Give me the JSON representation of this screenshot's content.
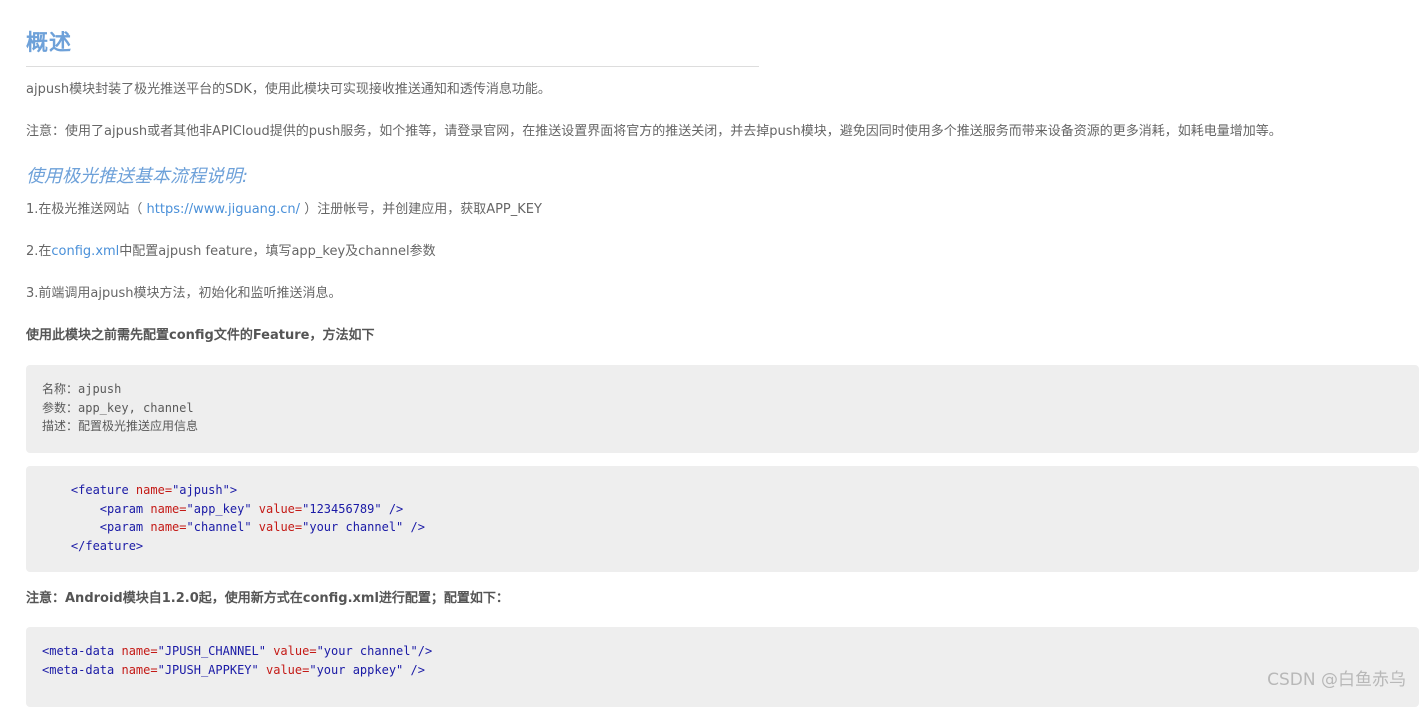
{
  "heading": "概述",
  "intro": "ajpush模块封装了极光推送平台的SDK，使用此模块可实现接收推送通知和透传消息功能。",
  "note": "注意：使用了ajpush或者其他非APICloud提供的push服务，如个推等，请登录官网，在推送设置界面将官方的推送关闭，并去掉push模块，避免因同时使用多个推送服务而带来设备资源的更多消耗，如耗电量增加等。",
  "flow_heading": "使用极光推送基本流程说明:",
  "steps": {
    "step1_prefix": "1.在极光推送网站（ ",
    "step1_link": "https://www.jiguang.cn/",
    "step1_suffix": " ）注册帐号，并创建应用，获取APP_KEY",
    "step2_prefix": "2.在",
    "step2_link": "config.xml",
    "step2_suffix": "中配置ajpush feature，填写app_key及channel参数",
    "step3": "3.前端调用ajpush模块方法，初始化和监听推送消息。"
  },
  "config_intro": "使用此模块之前需先配置config文件的Feature，方法如下",
  "meta_block": {
    "name_line": "名称：ajpush",
    "params_line": "参数：app_key, channel",
    "desc_line": "描述：配置极光推送应用信息"
  },
  "feature_block": {
    "open_tag": "<feature",
    "name_attr": " name=",
    "name_val": "\"ajpush\"",
    "open_end": ">",
    "param_tag": "<param",
    "param_name_attr": " name=",
    "param1_name": "\"app_key\"",
    "value_attr": " value=",
    "param1_value": "\"123456789\"",
    "self_close": " />",
    "param2_name": "\"channel\"",
    "param2_value": "\"your channel\"",
    "close_tag": "</feature>"
  },
  "android_note": "注意：Android模块自1.2.0起，使用新方式在config.xml进行配置；配置如下：",
  "android_block": {
    "meta_tag": "<meta-data",
    "name_attr": " name=",
    "value_attr": " value=",
    "line1_name": "\"JPUSH_CHANNEL\"",
    "line1_value": "\"your channel\"",
    "line1_close": "/>",
    "line2_name": "\"JPUSH_APPKEY\"",
    "line2_value": "\"your appkey\"",
    "line2_close": " />"
  },
  "watermark": "CSDN @白鱼赤乌",
  "colors": {
    "heading": "#6ea1d9",
    "link": "#4a90d9",
    "code_bg": "#eeeeee",
    "code_tag": "#1a1aa6",
    "code_attr": "#c41a16"
  }
}
